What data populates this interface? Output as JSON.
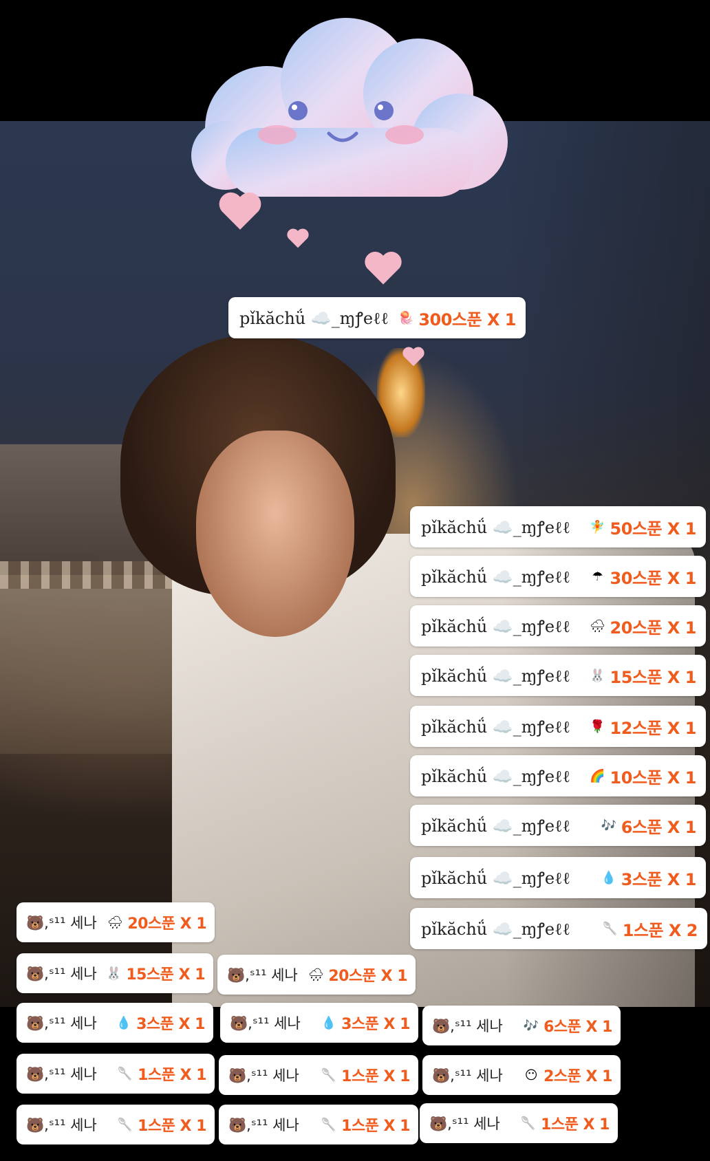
{
  "background": {
    "photo": "person-with-hand-on-cheek-evening-bridge"
  },
  "colors": {
    "amount_text": "#f05b1e",
    "pill_background": "#ffffff",
    "heart": "#f4b7c8",
    "cloud_blue": "#a9c8f4",
    "cloud_pink": "#f2c4dc"
  },
  "top_donation": {
    "sender": "pǐkăchǘ ☁️_ɱꝭeℓℓ",
    "icon": "jellyfish-icon",
    "amount": "300스푼 X 1"
  },
  "right_column": [
    {
      "sender": "pǐkăchǘ ☁️_ɱꝭeℓℓ",
      "icon": "fairy-icon",
      "amount": "50스푼 X 1"
    },
    {
      "sender": "pǐkăchǘ ☁️_ɱꝭeℓℓ",
      "icon": "umbrella-icon",
      "amount": "30스푼 X 1"
    },
    {
      "sender": "pǐkăchǘ ☁️_ɱꝭeℓℓ",
      "icon": "rain-cloud-icon",
      "amount": "20스푼 X 1"
    },
    {
      "sender": "pǐkăchǘ ☁️_ɱꝭeℓℓ",
      "icon": "bunny-icon",
      "amount": "15스푼 X 1"
    },
    {
      "sender": "pǐkăchǘ ☁️_ɱꝭeℓℓ",
      "icon": "rose-icon",
      "amount": "12스푼 X 1"
    },
    {
      "sender": "pǐkăchǘ ☁️_ɱꝭeℓℓ",
      "icon": "rainbow-icon",
      "amount": "10스푼 X 1"
    },
    {
      "sender": "pǐkăchǘ ☁️_ɱꝭeℓℓ",
      "icon": "music-notes-icon",
      "amount": "6스푼 X 1"
    },
    {
      "sender": "pǐkăchǘ ☁️_ɱꝭeℓℓ",
      "icon": "droplets-icon",
      "amount": "3스푼 X 1"
    },
    {
      "sender": "pǐkăchǘ ☁️_ɱꝭeℓℓ",
      "icon": "spoon-icon",
      "amount": "1스푼 X 2"
    }
  ],
  "senna_pills": [
    {
      "sender": "🐻,ˢ¹¹ 세나",
      "icon": "rain-cloud-icon",
      "amount": "20스푼 X 1"
    },
    {
      "sender": "🐻,ˢ¹¹ 세나",
      "icon": "bunny-icon",
      "amount": "15스푼 X 1"
    },
    {
      "sender": "🐻,ˢ¹¹ 세나",
      "icon": "rain-cloud-icon",
      "amount": "20스푼 X 1"
    },
    {
      "sender": "🐻,ˢ¹¹ 세나",
      "icon": "droplets-icon",
      "amount": "3스푼 X 1"
    },
    {
      "sender": "🐻,ˢ¹¹ 세나",
      "icon": "droplets-icon",
      "amount": "3스푼 X 1"
    },
    {
      "sender": "🐻,ˢ¹¹ 세나",
      "icon": "music-notes-icon",
      "amount": "6스푼 X 1"
    },
    {
      "sender": "🐻,ˢ¹¹ 세나",
      "icon": "spoon-icon",
      "amount": "1스푼 X 1"
    },
    {
      "sender": "🐻,ˢ¹¹ 세나",
      "icon": "spoon-icon",
      "amount": "1스푼 X 1"
    },
    {
      "sender": "🐻,ˢ¹¹ 세나",
      "icon": "face-icon",
      "amount": "2스푼 X 1"
    },
    {
      "sender": "🐻,ˢ¹¹ 세나",
      "icon": "spoon-icon",
      "amount": "1스푼 X 1"
    },
    {
      "sender": "🐻,ˢ¹¹ 세나",
      "icon": "spoon-icon",
      "amount": "1스푼 X 1"
    },
    {
      "sender": "🐻,ˢ¹¹ 세나",
      "icon": "spoon-icon",
      "amount": "1스푼 X 1"
    }
  ]
}
